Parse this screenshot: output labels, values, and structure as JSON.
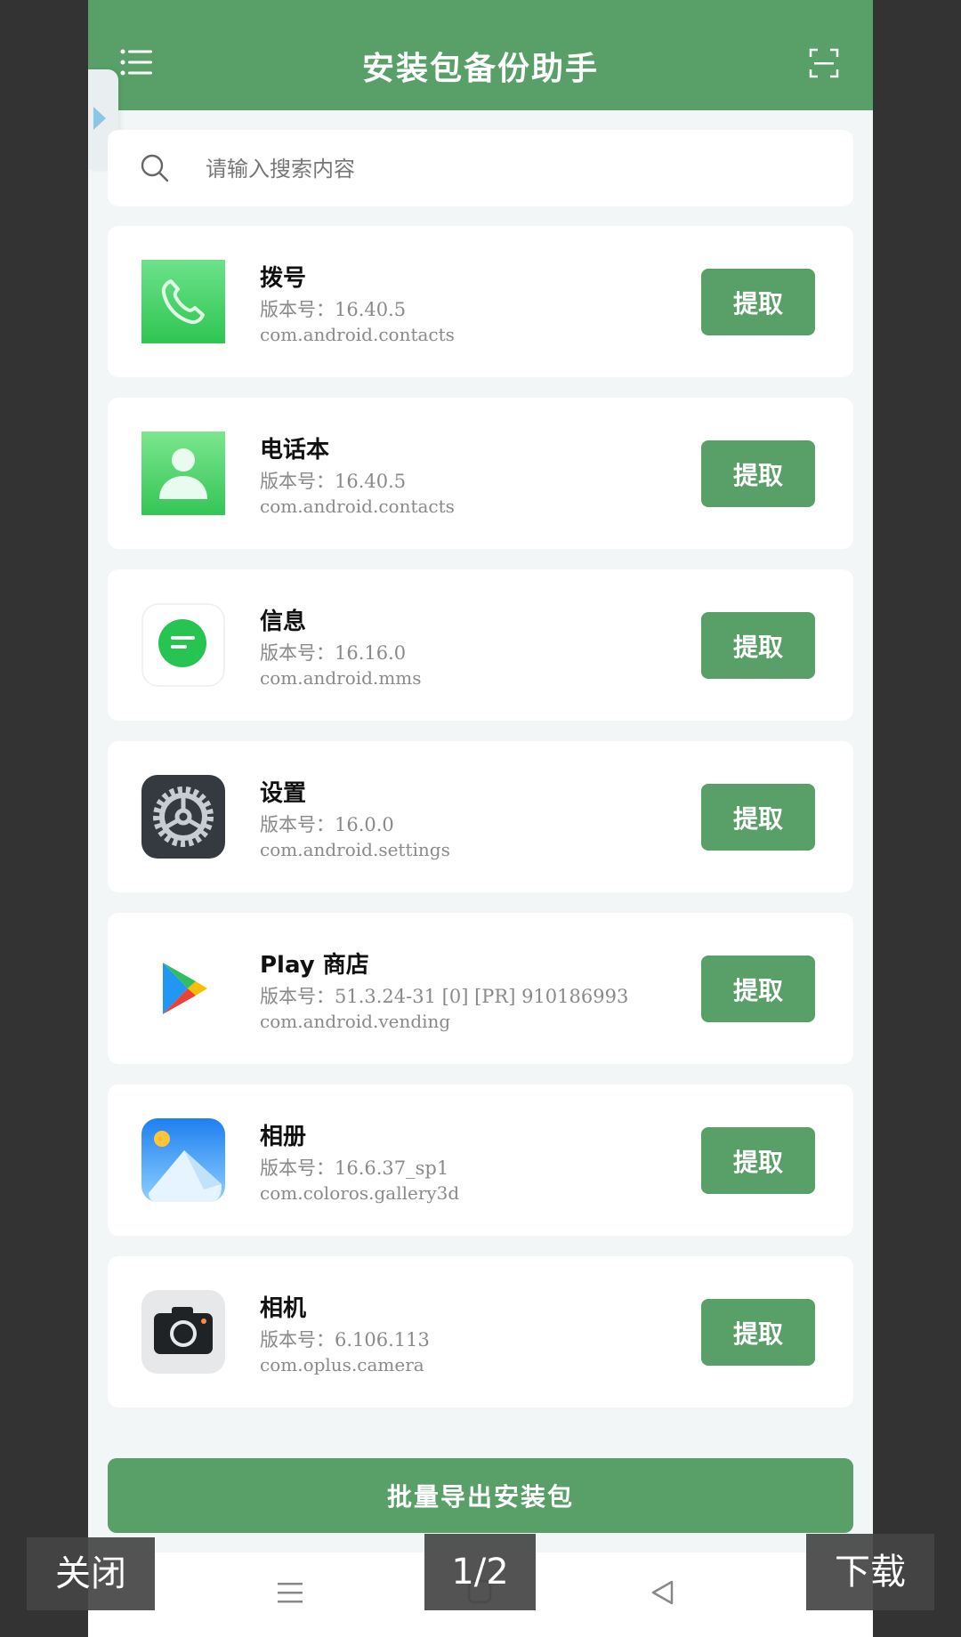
{
  "header": {
    "title": "安装包备份助手",
    "menu_icon": "menu-icon",
    "scan_icon": "scan-icon"
  },
  "search": {
    "placeholder": "请输入搜索内容",
    "icon": "search-icon"
  },
  "apps": [
    {
      "name": "拨号",
      "version": "版本号：16.40.5",
      "package": "com.android.contacts",
      "icon": "phone-icon",
      "action": "提取"
    },
    {
      "name": "电话本",
      "version": "版本号：16.40.5",
      "package": "com.android.contacts",
      "icon": "contacts-icon",
      "action": "提取"
    },
    {
      "name": "信息",
      "version": "版本号：16.16.0",
      "package": "com.android.mms",
      "icon": "message-icon",
      "action": "提取"
    },
    {
      "name": "设置",
      "version": "版本号：16.0.0",
      "package": "com.android.settings",
      "icon": "settings-icon",
      "action": "提取"
    },
    {
      "name": "Play 商店",
      "version": "版本号：51.3.24-31 [0] [PR] 910186993",
      "package": "com.android.vending",
      "icon": "play-store-icon",
      "action": "提取"
    },
    {
      "name": "相册",
      "version": "版本号：16.6.37_sp1",
      "package": "com.coloros.gallery3d",
      "icon": "gallery-icon",
      "action": "提取"
    },
    {
      "name": "相机",
      "version": "版本号：6.106.113",
      "package": "com.oplus.camera",
      "icon": "camera-icon",
      "action": "提取"
    }
  ],
  "export_button": "批量导出安装包",
  "overlay": {
    "close": "关闭",
    "page": "1/2",
    "download": "下载"
  },
  "colors": {
    "primary": "#58a068",
    "background": "#f2f6f6"
  }
}
